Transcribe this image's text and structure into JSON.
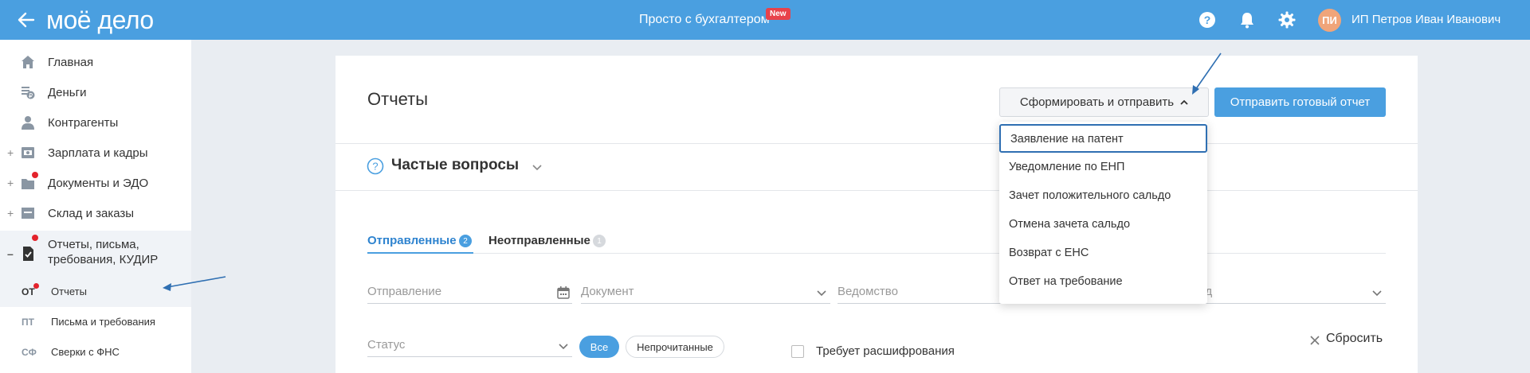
{
  "topbar": {
    "logo": "моё дело",
    "center_title": "Просто с бухгалтером",
    "new_badge": "New",
    "avatar_initials": "ПИ",
    "user_name": "ИП Петров Иван Иванович"
  },
  "sidebar": {
    "items": [
      {
        "label": "Главная",
        "icon": "home-icon"
      },
      {
        "label": "Деньги",
        "icon": "money-icon"
      },
      {
        "label": "Контрагенты",
        "icon": "contacts-icon"
      },
      {
        "label": "Зарплата и кадры",
        "icon": "salary-icon"
      },
      {
        "label": "Документы и ЭДО",
        "icon": "documents-icon"
      },
      {
        "label": "Склад и заказы",
        "icon": "warehouse-icon"
      },
      {
        "label_line1": "Отчеты, письма,",
        "label_line2": "требования, КУДИР",
        "icon": "reports-icon"
      }
    ],
    "subitems": [
      {
        "abbr": "ОТ",
        "label": "Отчеты"
      },
      {
        "abbr": "ПТ",
        "label": "Письма и требования"
      },
      {
        "abbr": "СФ",
        "label": "Сверки с ФНС"
      }
    ]
  },
  "main": {
    "title": "Отчеты",
    "form_button": "Сформировать и отправить",
    "send_button": "Отправить готовый отчет",
    "faq_title": "Частые вопросы",
    "tabs": [
      {
        "label": "Отправленные",
        "count": "2"
      },
      {
        "label": "Неотправленные",
        "count": "1"
      }
    ],
    "filters": {
      "sending": "Отправление",
      "document": "Документ",
      "agency": "Ведомство",
      "period_partial": "иод",
      "status": "Статус"
    },
    "chips": {
      "all": "Все",
      "unread": "Непрочитанные"
    },
    "checkbox_label": "Требует расшифрования",
    "reset": "Сбросить"
  },
  "dropdown": {
    "items": [
      "Заявление на патент",
      "Уведомление по ЕНП",
      "Зачет положительного сальдо",
      "Отмена зачета сальдо",
      "Возврат с ЕНС",
      "Ответ на требование"
    ]
  },
  "colors": {
    "accent": "#4a9fe0",
    "badge_red": "#e8424b",
    "avatar": "#f0a57a"
  }
}
